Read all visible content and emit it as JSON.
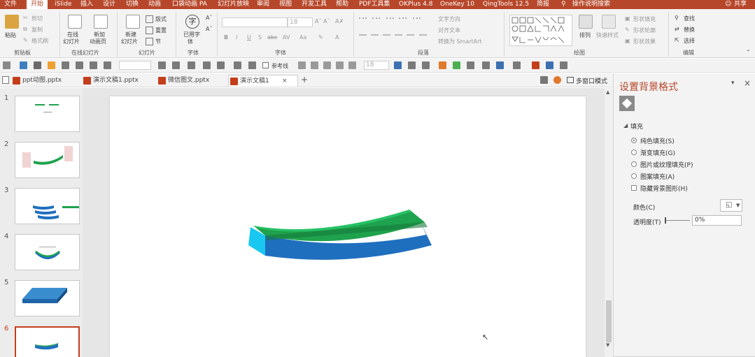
{
  "menubar": {
    "items": [
      "文件",
      "开始",
      "iSlide",
      "插入",
      "设计",
      "切换",
      "动画",
      "口袋动画 PA",
      "幻灯片放映",
      "审阅",
      "视图",
      "开发工具",
      "帮助",
      "PDF工具集",
      "OKPlus 4.8",
      "OneKey 10",
      "QingTools 12.5",
      "简报"
    ],
    "search": "操作说明搜索",
    "share": "共享"
  },
  "ribbon": {
    "clipboard": {
      "paste": "粘贴",
      "cut": "剪切",
      "copy": "复制",
      "painter": "格式刷",
      "label": "剪贴板"
    },
    "online": {
      "online_slide": "在线",
      "online_slide2": "幻灯片",
      "new_page": "新加",
      "new_page2": "动画页",
      "label": "在线幻灯片"
    },
    "slides": {
      "new": "新建",
      "new2": "幻灯片",
      "layout": "版式",
      "reset": "重置",
      "section": "节",
      "label": "幻灯片"
    },
    "fontuse": {
      "btn": "已用字",
      "btn2": "体",
      "label": "字体"
    },
    "font": {
      "size": "18",
      "label": "字体",
      "bold": "B",
      "italic": "I",
      "underline": "U",
      "strike": "S",
      "abc": "abc",
      "spacing": "AV",
      "case": "Aa"
    },
    "paragraph": {
      "textdir": "文字方向",
      "align": "对齐文本",
      "smartart": "转换为 SmartArt",
      "label": "段落"
    },
    "drawing": {
      "arrange": "排列",
      "quickstyle": "快速样式",
      "fill": "形状填充",
      "outline": "形状轮廓",
      "effect": "形状效果",
      "label": "绘图"
    },
    "editing": {
      "find": "查找",
      "replace": "替换",
      "select": "选择",
      "label": "编辑"
    }
  },
  "qat": {
    "size": "18",
    "guides": "参考线"
  },
  "tabs": [
    "ppt动图.pptx",
    "演示文稿1.pptx",
    "微信图文.pptx",
    "演示文稿1"
  ],
  "tabbar": {
    "close": "×",
    "add": "+",
    "multiwin": "多窗口模式"
  },
  "slides": [
    "1",
    "2",
    "3",
    "4",
    "5",
    "6"
  ],
  "pane": {
    "title": "设置背景格式",
    "fill_section": "填充",
    "options": [
      "纯色填充(S)",
      "渐变填充(G)",
      "图片或纹理填充(P)",
      "图案填充(A)"
    ],
    "hide_graphics": "隐藏背景图形(H)",
    "color_label": "颜色(C)",
    "transparency_label": "透明度(T)",
    "transparency_value": "0%"
  },
  "colors": {
    "accent": "#b7472a",
    "green": "#1fa24d",
    "blue": "#1f6fbf",
    "cyan": "#19c8f0"
  }
}
